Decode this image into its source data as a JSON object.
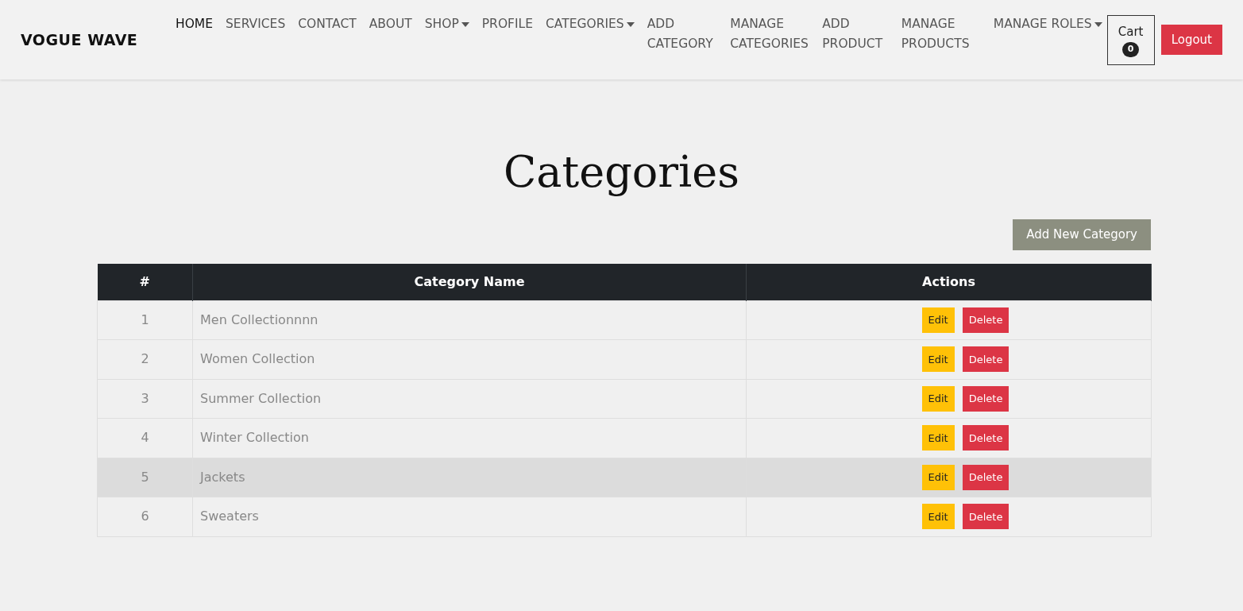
{
  "navbar": {
    "brand": "VOGUE WAVE",
    "items": [
      {
        "label": "HOME",
        "selected": true,
        "dropdown": false
      },
      {
        "label": "SERVICES",
        "selected": false,
        "dropdown": false
      },
      {
        "label": "CONTACT",
        "selected": false,
        "dropdown": false
      },
      {
        "label": "ABOUT",
        "selected": false,
        "dropdown": false
      },
      {
        "label": "SHOP",
        "selected": false,
        "dropdown": true
      },
      {
        "label": "PROFILE",
        "selected": false,
        "dropdown": false
      },
      {
        "label": "CATEGORIES",
        "selected": false,
        "dropdown": true
      },
      {
        "label": "ADD CATEGORY",
        "selected": false,
        "dropdown": false
      },
      {
        "label": "MANAGE CATEGORIES",
        "selected": false,
        "dropdown": false
      },
      {
        "label": "ADD PRODUCT",
        "selected": false,
        "dropdown": false
      },
      {
        "label": "MANAGE PRODUCTS",
        "selected": false,
        "dropdown": false
      },
      {
        "label": "MANAGE ROLES",
        "selected": false,
        "dropdown": true
      }
    ],
    "cart": {
      "label": "Cart",
      "count": "0"
    },
    "logout": "Logout"
  },
  "page": {
    "title": "Categories",
    "add_button": "Add New Category"
  },
  "table": {
    "columns": [
      "#",
      "Category Name",
      "Actions"
    ],
    "rows": [
      {
        "index": "1",
        "name": "Men Collectionnnn",
        "edit": "Edit",
        "delete": "Delete",
        "highlighted": false
      },
      {
        "index": "2",
        "name": "Women Collection",
        "edit": "Edit",
        "delete": "Delete",
        "highlighted": false
      },
      {
        "index": "3",
        "name": "Summer Collection",
        "edit": "Edit",
        "delete": "Delete",
        "highlighted": false
      },
      {
        "index": "4",
        "name": "Winter Collection",
        "edit": "Edit",
        "delete": "Delete",
        "highlighted": false
      },
      {
        "index": "5",
        "name": "Jackets",
        "edit": "Edit",
        "delete": "Delete",
        "highlighted": true
      },
      {
        "index": "6",
        "name": "Sweaters",
        "edit": "Edit",
        "delete": "Delete",
        "highlighted": false
      }
    ]
  }
}
